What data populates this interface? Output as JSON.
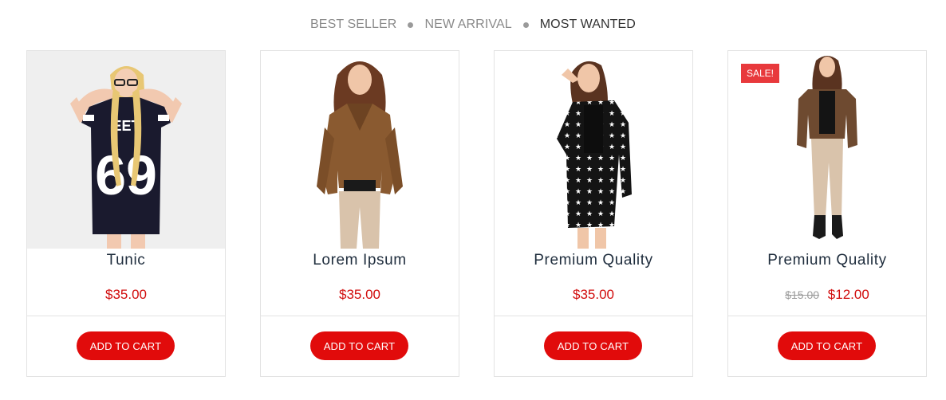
{
  "tabs": [
    "BEST SELLER",
    "NEW ARRIVAL",
    "MOST WANTED"
  ],
  "active_tab": "MOST WANTED",
  "products": [
    {
      "name": "Tunic",
      "price": "$35.00",
      "old_price": "",
      "badge": "",
      "button": "ADD TO CART"
    },
    {
      "name": "Lorem Ipsum",
      "price": "$35.00",
      "old_price": "",
      "badge": "",
      "button": "ADD TO CART"
    },
    {
      "name": "Premium Quality",
      "price": "$35.00",
      "old_price": "",
      "badge": "",
      "button": "ADD TO CART"
    },
    {
      "name": "Premium Quality",
      "price": "$12.00",
      "old_price": "$15.00",
      "badge": "SALE!",
      "button": "ADD TO CART"
    }
  ],
  "colors": {
    "accent": "#e10b0b",
    "sale_badge": "#e8393c",
    "title": "#1f2d3d"
  }
}
